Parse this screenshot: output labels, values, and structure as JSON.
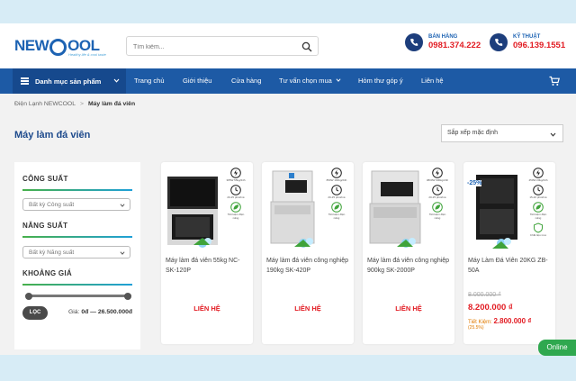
{
  "brand": {
    "logo_text_left": "NEW",
    "logo_text_right": "OOL",
    "logo_tag": "Healthy life & cool taste"
  },
  "search": {
    "placeholder": "Tìm kiếm..."
  },
  "hotlines": [
    {
      "label": "BÁN HÀNG",
      "number": "0981.374.222"
    },
    {
      "label": "KỸ THUẬT",
      "number": "096.139.1551"
    }
  ],
  "nav": {
    "category_button": "Danh mục sản phẩm",
    "items": [
      "Trang chủ",
      "Giới thiệu",
      "Cửa hàng",
      "Tư vấn chọn mua",
      "Hòm thư góp ý",
      "Liên hệ"
    ]
  },
  "breadcrumb": {
    "home": "Điện Lạnh NEWCOOL",
    "separator": ">",
    "current": "Máy làm đá viên"
  },
  "page_title": "Máy làm đá viên",
  "sort": {
    "selected": "Sắp xếp mặc định"
  },
  "filters": {
    "capacity": {
      "title": "CÔNG SUẤT",
      "select": "Bất kỳ Công suất"
    },
    "output": {
      "title": "NĂNG SUẤT",
      "select": "Bất kỳ Năng suất"
    },
    "price": {
      "title": "KHOẢNG GIÁ",
      "button": "LỌC",
      "label": "Giá:",
      "range_text": "0đ — 26.500.000đ",
      "min_fraction": 0,
      "max_fraction": 1
    }
  },
  "products": [
    {
      "name": "Máy làm đá viên 55kg NC-SK-120P",
      "cta": "LIÊN HỆ",
      "specs": [
        "385W 55kg/24h",
        "20-25 phút/mẻ",
        "Tiết kiệm điện năng"
      ]
    },
    {
      "name": "Máy làm đá viên công nghiệp 190kg SK-420P",
      "cta": "LIÊN HỆ",
      "specs": [
        "850W 190kg/24h",
        "20-25 phút/mẻ",
        "Tiết kiệm điện năng"
      ]
    },
    {
      "name": "Máy làm đá viên công nghiệp 900kg SK-2000P",
      "cta": "LIÊN HỆ",
      "specs": [
        "3800W 900kg/24h",
        "20-25 phút/mẻ",
        "Tiết kiệm điện năng"
      ]
    },
    {
      "name": "Máy Làm Đá Viên 20KG ZB-50A",
      "old_price": "8.000.000 ₫",
      "new_price": "8.200.000 ₫",
      "save_label": "Tiết Kiệm:",
      "save_amount": "2.800.000 ₫",
      "save_pct": "(25.5%)",
      "badge": "-25%",
      "specs": [
        "450W 20kg/24h",
        "15-20 phút/mẻ",
        "Tiết kiệm điện năng",
        "Chất liệu inox"
      ]
    }
  ],
  "chat": {
    "label": "Online"
  },
  "colors": {
    "brand_blue": "#1d63b3",
    "nav_blue": "#1d5aa5",
    "price_red": "#e21c23",
    "online_green": "#2fa84f",
    "title_blue": "#1d4a8c"
  }
}
